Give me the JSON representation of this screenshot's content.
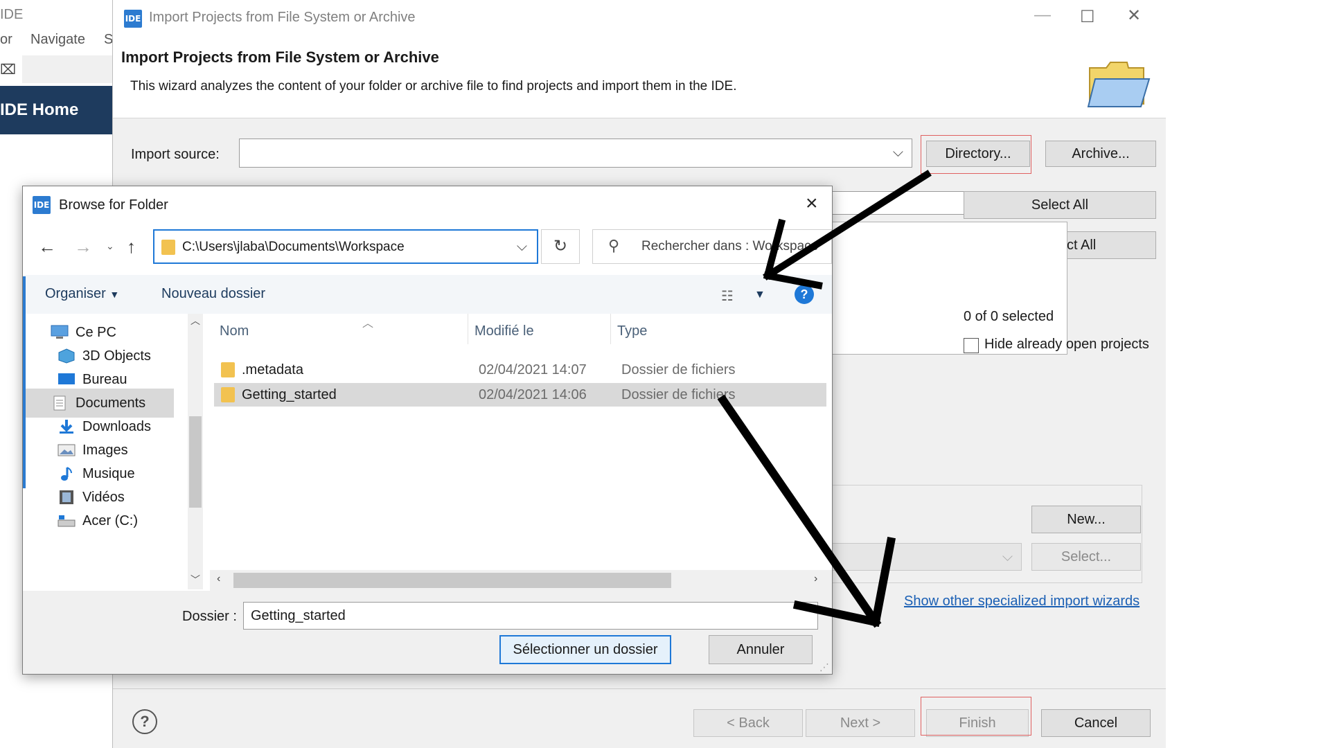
{
  "ide": {
    "title": "IDE",
    "menu": [
      "or",
      "Navigate",
      "S"
    ],
    "home_tab": "IDE Home"
  },
  "import_dialog": {
    "window_title": "Import Projects from File System or Archive",
    "logo_text": "IDE",
    "heading": "Import Projects from File System or Archive",
    "description": "This wizard analyzes the content of your folder or archive file to find projects and import them in the IDE.",
    "import_source_label": "Import source:",
    "import_source_value": "",
    "directory_button": "Directory...",
    "archive_button": "Archive...",
    "select_all_button": "Select All",
    "deselect_all_button": "Deselect All",
    "selected_count": "0 of 0 selected",
    "hide_open_label": "Hide already open projects",
    "new_button": "New...",
    "select_button": "Select...",
    "specialized_link": "Show other specialized import wizards",
    "back_button": "< Back",
    "next_button": "Next >",
    "finish_button": "Finish",
    "cancel_button": "Cancel"
  },
  "browse_dialog": {
    "title": "Browse for Folder",
    "logo_text": "IDE",
    "address": "C:\\Users\\jlaba\\Documents\\Workspace",
    "search_placeholder": "Rechercher dans : Workspace",
    "organiser": "Organiser",
    "nouveau_dossier": "Nouveau dossier",
    "nav_items": [
      {
        "label": "Ce PC",
        "icon": "computer-icon"
      },
      {
        "label": "3D Objects",
        "icon": "cube-icon"
      },
      {
        "label": "Bureau",
        "icon": "desktop-icon"
      },
      {
        "label": "Documents",
        "icon": "document-icon"
      },
      {
        "label": "Downloads",
        "icon": "download-icon"
      },
      {
        "label": "Images",
        "icon": "image-icon"
      },
      {
        "label": "Musique",
        "icon": "music-icon"
      },
      {
        "label": "Vidéos",
        "icon": "video-icon"
      },
      {
        "label": "Acer (C:)",
        "icon": "drive-icon"
      }
    ],
    "selected_nav": "Documents",
    "columns": [
      "Nom",
      "Modifié le",
      "Type"
    ],
    "files": [
      {
        "name": ".metadata",
        "modified": "02/04/2021 14:07",
        "type": "Dossier de fichiers"
      },
      {
        "name": "Getting_started",
        "modified": "02/04/2021 14:06",
        "type": "Dossier de fichiers"
      }
    ],
    "selected_file": "Getting_started",
    "dossier_label": "Dossier :",
    "dossier_value": "Getting_started",
    "select_folder_button": "Sélectionner un dossier",
    "cancel_button": "Annuler"
  },
  "colors": {
    "accent": "#1e78d7",
    "highlight_red": "#e06060",
    "ide_home_bg": "#1e3b5e",
    "folder_yellow": "#f2c250"
  }
}
